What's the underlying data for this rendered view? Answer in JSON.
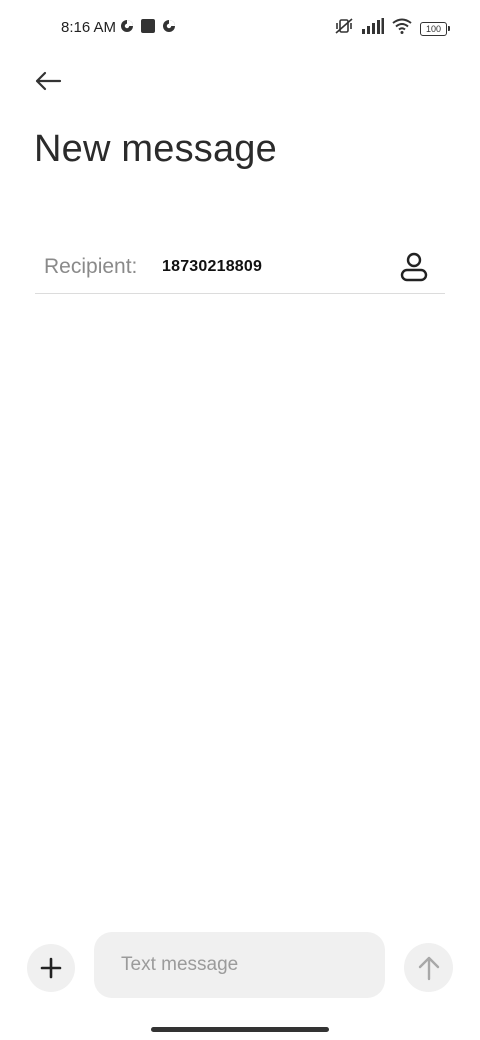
{
  "status_bar": {
    "time": "8:16 AM",
    "left_icons": [
      "data-saver-icon",
      "square-notification-icon",
      "data-saver-icon"
    ],
    "right_icons": [
      "vibrate-off-icon",
      "signal-icon",
      "wifi-icon",
      "battery-icon"
    ],
    "battery_level": "100"
  },
  "header": {
    "back_icon": "arrow-left-icon",
    "title": "New message"
  },
  "recipient": {
    "label": "Recipient:",
    "value": "18730218809",
    "contact_icon": "person-icon"
  },
  "compose": {
    "attach_icon": "plus-icon",
    "placeholder": "Text message",
    "value": "",
    "send_icon": "arrow-up-icon"
  },
  "colors": {
    "background": "#ffffff",
    "input_background": "#f0f0f0",
    "label_gray": "#8a8a8a",
    "divider": "#dcdcdc"
  }
}
